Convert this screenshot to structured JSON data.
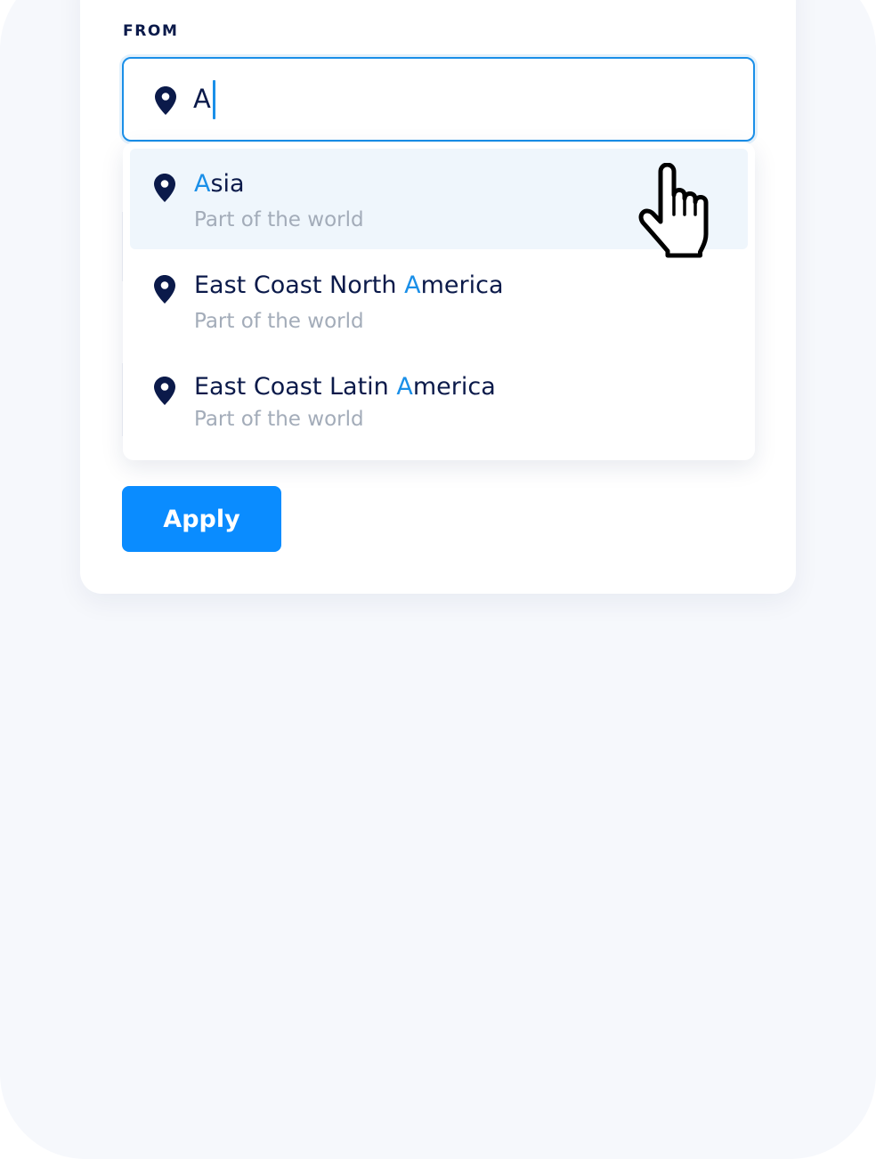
{
  "from": {
    "label": "FROM",
    "value": "A",
    "icon": "location-pin-icon"
  },
  "dropdown": {
    "options": [
      {
        "match": "A",
        "rest": "sia",
        "prefix": "",
        "subtitle": "Part of the world",
        "active": true
      },
      {
        "prefix": "East Coast North ",
        "match": "A",
        "rest": "merica",
        "subtitle": "Part of the world",
        "active": false
      },
      {
        "prefix": "East Coast Latin ",
        "match": "A",
        "rest": "merica",
        "subtitle": "Part of the world",
        "active": false
      }
    ]
  },
  "apply_label": "Apply",
  "colors": {
    "accent": "#1a8fe8",
    "button": "#0a8cff",
    "text": "#0b1a4a",
    "muted": "#a3acb9",
    "active_row": "#eff6fc"
  },
  "cursor_icon": "hand-pointer-icon"
}
